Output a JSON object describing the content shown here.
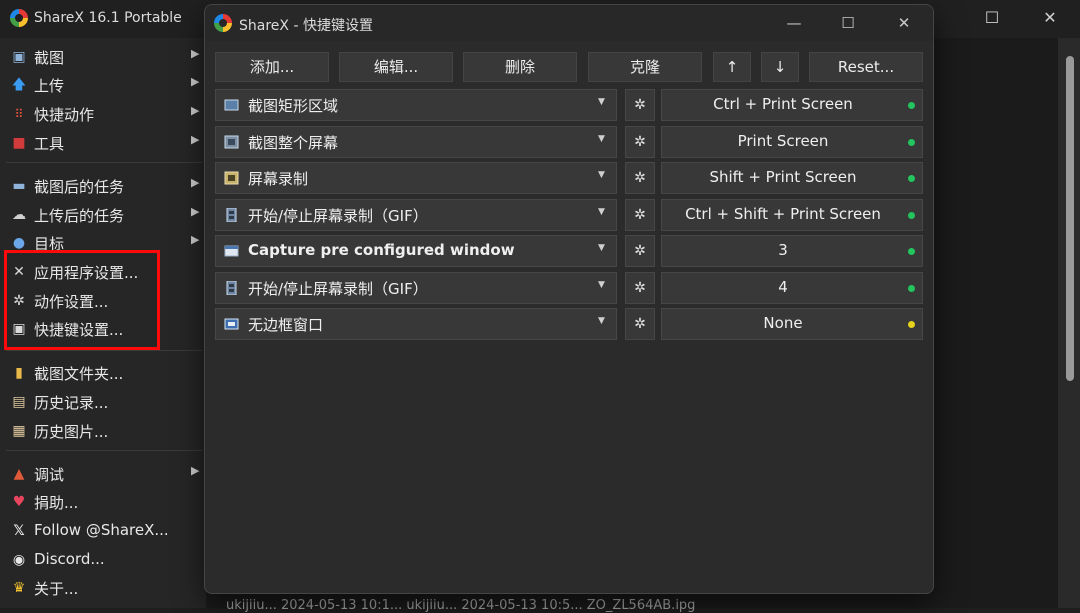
{
  "main": {
    "title": "ShareX 16.1 Portable",
    "menu": [
      {
        "label": "截图",
        "icon": "screenshot-icon",
        "arrow": true
      },
      {
        "label": "上传",
        "icon": "upload-arrow-icon",
        "arrow": true
      },
      {
        "label": "快捷动作",
        "icon": "quick-actions-grid-icon",
        "arrow": true
      },
      {
        "label": "工具",
        "icon": "toolbox-icon",
        "arrow": true
      },
      {
        "label": "截图后的任务",
        "icon": "after-capture-icon",
        "arrow": true
      },
      {
        "label": "上传后的任务",
        "icon": "cloud-upload-icon",
        "arrow": true
      },
      {
        "label": "目标",
        "icon": "destination-icon",
        "arrow": true
      },
      {
        "label": "应用程序设置...",
        "icon": "wrench-tools-icon",
        "arrow": false
      },
      {
        "label": "动作设置...",
        "icon": "gear-icon",
        "arrow": false
      },
      {
        "label": "快捷键设置...",
        "icon": "keyboard-icon",
        "arrow": false
      },
      {
        "label": "截图文件夹...",
        "icon": "folder-icon",
        "arrow": false
      },
      {
        "label": "历史记录...",
        "icon": "history-icon",
        "arrow": false
      },
      {
        "label": "历史图片...",
        "icon": "image-history-icon",
        "arrow": false
      },
      {
        "label": "调试",
        "icon": "debug-icon",
        "arrow": true
      },
      {
        "label": "捐助...",
        "icon": "heart-icon",
        "arrow": false
      },
      {
        "label": "Follow @ShareX...",
        "icon": "x-logo-icon",
        "arrow": false
      },
      {
        "label": "Discord...",
        "icon": "discord-icon",
        "arrow": false
      },
      {
        "label": "关于...",
        "icon": "crown-icon",
        "arrow": false
      }
    ],
    "bottom_text": "ukijiiu... 2024-05-13 10:1... ukijiiu... 2024-05-13 10:5... ZO_ZL564AB.ipg"
  },
  "dialog": {
    "title": "ShareX - 快捷键设置",
    "toolbar": {
      "add": "添加...",
      "edit": "编辑...",
      "delete": "删除",
      "clone": "克隆",
      "up": "↑",
      "down": "↓",
      "reset": "Reset..."
    },
    "hotkeys": [
      {
        "task": "截图矩形区域",
        "hotkey": "Ctrl + Print Screen",
        "status": "green",
        "bold": false
      },
      {
        "task": "截图整个屏幕",
        "hotkey": "Print Screen",
        "status": "green",
        "bold": false
      },
      {
        "task": "屏幕录制",
        "hotkey": "Shift + Print Screen",
        "status": "green",
        "bold": false
      },
      {
        "task": "开始/停止屏幕录制（GIF）",
        "hotkey": "Ctrl + Shift + Print Screen",
        "status": "green",
        "bold": false
      },
      {
        "task": "Capture pre configured window",
        "hotkey": "3",
        "status": "green",
        "bold": true
      },
      {
        "task": "开始/停止屏幕录制（GIF）",
        "hotkey": "4",
        "status": "green",
        "bold": false
      },
      {
        "task": "无边框窗口",
        "hotkey": "None",
        "status": "yellow",
        "bold": false
      }
    ]
  },
  "colors": {
    "highlight_box": "#ff0a0a",
    "status_green": "#22c55e",
    "status_yellow": "#e8d31c"
  }
}
